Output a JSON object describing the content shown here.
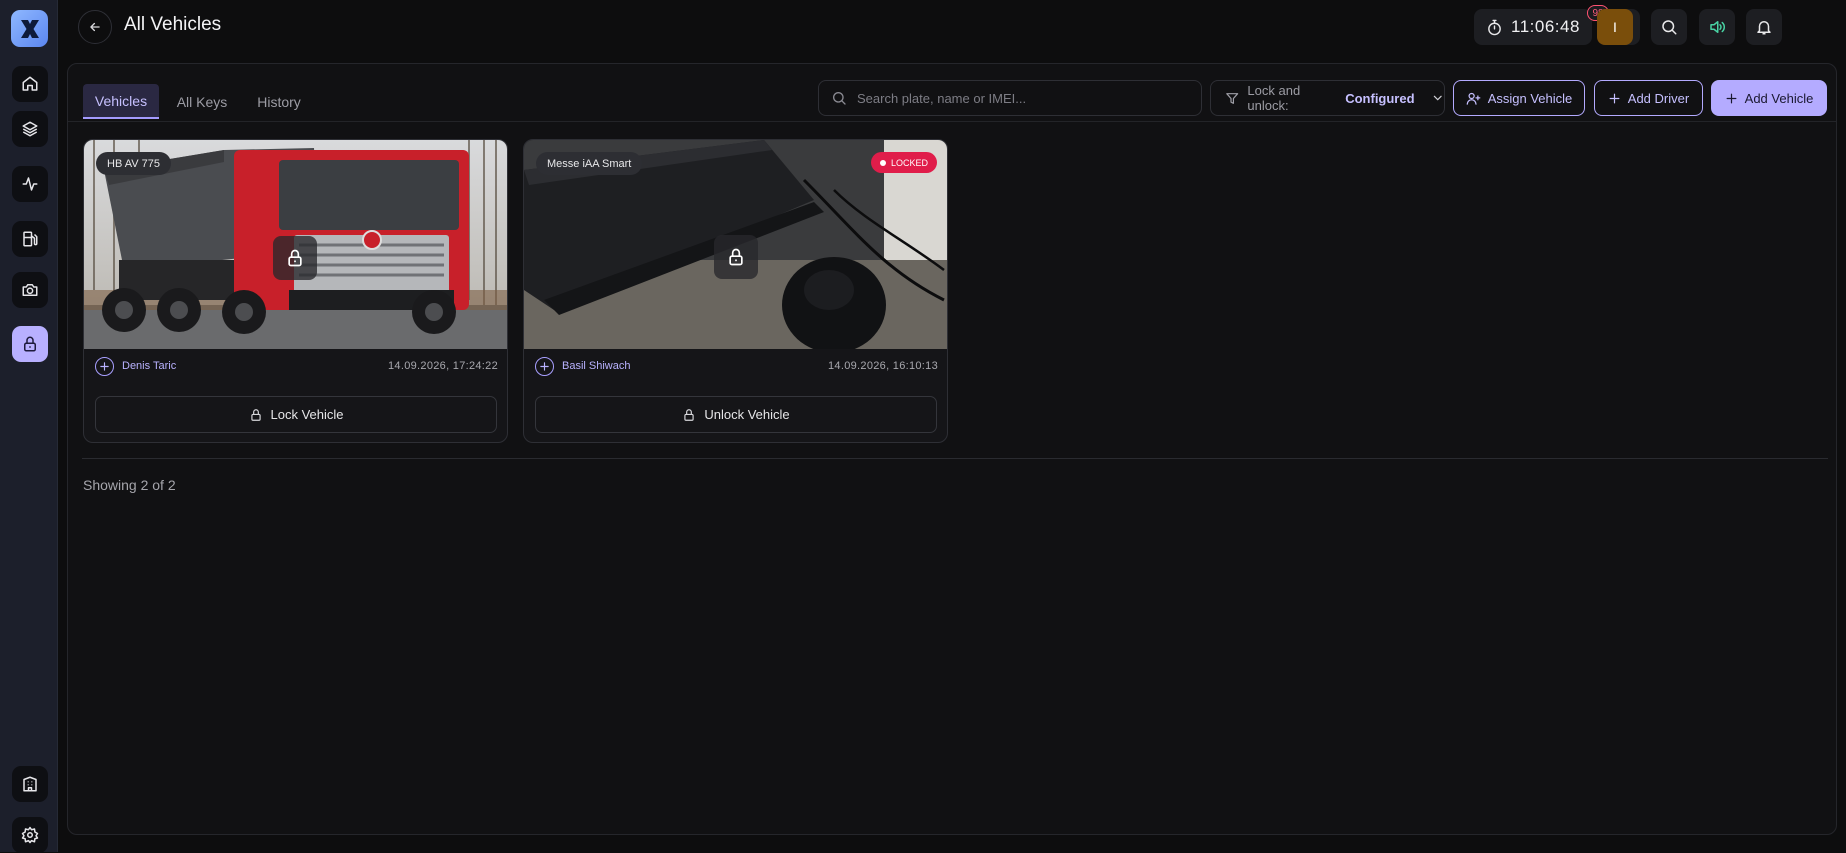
{
  "app": {
    "logo_icon": "x-logo-icon",
    "accent": "#b4abff"
  },
  "sidebar": {
    "items": [
      {
        "name": "home",
        "icon": "home-icon"
      },
      {
        "name": "layers",
        "icon": "layers-icon"
      },
      {
        "name": "activity",
        "icon": "activity-icon"
      },
      {
        "name": "fuel",
        "icon": "fuel-icon"
      },
      {
        "name": "camera",
        "icon": "camera-icon"
      },
      {
        "name": "lock",
        "icon": "lock-icon",
        "active": true
      }
    ],
    "bottom": [
      {
        "name": "building",
        "icon": "building-icon"
      },
      {
        "name": "settings",
        "icon": "gear-icon"
      }
    ]
  },
  "header": {
    "title": "All Vehicles",
    "clock": "11:06:48",
    "notifications_count": "98",
    "avatar_initial": "I"
  },
  "tabs": [
    {
      "label": "Vehicles",
      "active": true
    },
    {
      "label": "All Keys",
      "active": false
    },
    {
      "label": "History",
      "active": false
    }
  ],
  "toolbar": {
    "search_placeholder": "Search plate, name or IMEI...",
    "filter_label": "Lock and unlock:",
    "filter_value": "Configured",
    "assign_vehicle": "Assign Vehicle",
    "add_driver": "Add Driver",
    "add_vehicle": "Add Vehicle"
  },
  "vehicles": [
    {
      "plate": "HB AV 775",
      "locked_badge": "",
      "driver": "Denis Taric",
      "timestamp": "14.09.2026, 17:24:22",
      "action": "Lock Vehicle"
    },
    {
      "plate": "Messe iAA Smart",
      "locked_badge": "LOCKED",
      "driver": "Basil Shiwach",
      "timestamp": "14.09.2026, 16:10:13",
      "action": "Unlock Vehicle"
    }
  ],
  "footer": {
    "showing": "Showing 2 of 2"
  }
}
